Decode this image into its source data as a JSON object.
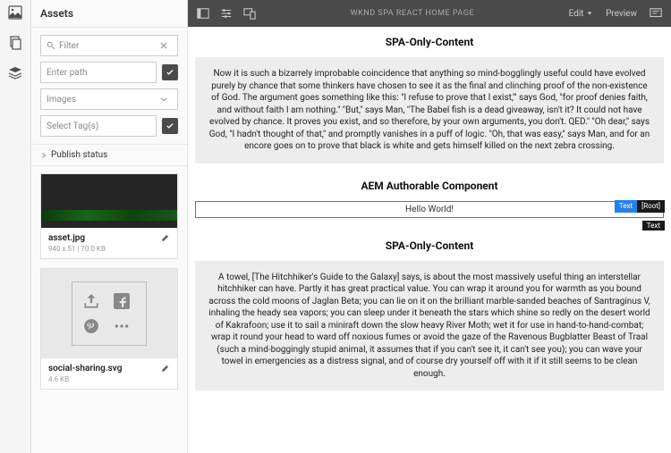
{
  "rail": {
    "icons": [
      "assets-icon",
      "copy-icon",
      "layers-icon"
    ]
  },
  "panel": {
    "title": "Assets",
    "filter": {
      "placeholder": "Filter"
    },
    "path": {
      "placeholder": "Enter path"
    },
    "type": {
      "label": "Images"
    },
    "tags": {
      "placeholder": "Select Tag(s)"
    },
    "publish": "Publish status"
  },
  "assets": [
    {
      "name": "asset.jpg",
      "meta": "940 x 51 | 70.0 KB"
    },
    {
      "name": "social-sharing.svg",
      "meta": "4.6 KB"
    }
  ],
  "topbar": {
    "title": "WKND SPA REACT HOME PAGE",
    "edit": "Edit",
    "preview": "Preview"
  },
  "content": {
    "h1": "SPA-Only-Content",
    "p1": "Now it is such a bizarrely improbable coincidence that anything so mind-bogglingly useful could have evolved purely by chance that some thinkers have chosen to see it as the final and clinching proof of the non-existence of God. The argument goes something like this: \"I refuse to prove that I exist,'\" says God, \"for proof denies faith, and without faith I am nothing.\" \"But,\" says Man, \"The Babel fish is a dead giveaway, isn't it? It could not have evolved by chance. It proves you exist, and so therefore, by your own arguments, you don't. QED.\" \"Oh dear,\" says God, \"I hadn't thought of that,\" and promptly vanishes in a puff of logic. \"Oh, that was easy,\" says Man, and for an encore goes on to prove that black is white and gets himself killed on the next zebra crossing.",
    "h2": "AEM Authorable Component",
    "hello": "Hello World!",
    "badge1": "Text",
    "badge2": "[Root]",
    "badge3": "Text",
    "h3": "SPA-Only-Content",
    "p2": "A towel, [The Hitchhiker's Guide to the Galaxy] says, is about the most massively useful thing an interstellar hitchhiker can have. Partly it has great practical value. You can wrap it around you for warmth as you bound across the cold moons of Jaglan Beta; you can lie on it on the brilliant marble-sanded beaches of Santraginus V, inhaling the heady sea vapors; you can sleep under it beneath the stars which shine so redly on the desert world of Kakrafoon; use it to sail a miniraft down the slow heavy River Moth; wet it for use in hand-to-hand-combat; wrap it round your head to ward off noxious fumes or avoid the gaze of the Ravenous Bugblatter Beast of Traal (such a mind-boggingly stupid animal, it assumes that if you can't see it, it can't see you); you can wave your towel in emergencies as a distress signal, and of course dry yourself off with it if it still seems to be clean enough."
  }
}
